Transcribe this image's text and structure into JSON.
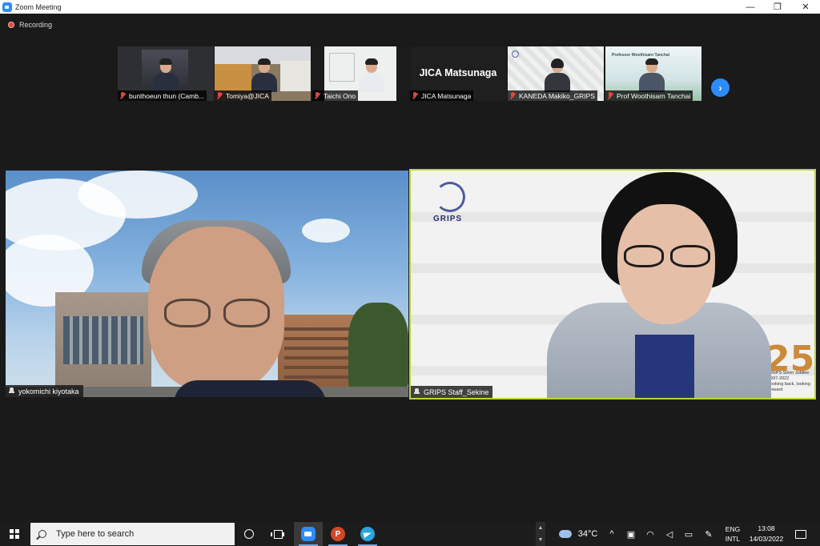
{
  "window": {
    "title": "Zoom Meeting",
    "controls": {
      "minimize": "—",
      "restore": "❐",
      "close": "✕"
    }
  },
  "meeting": {
    "recording_label": "Recording",
    "thumbnails": [
      {
        "name": "bunthoeun thun (Camb..."
      },
      {
        "name": "Tomiya@JICA"
      },
      {
        "name": "Taichi Ono"
      },
      {
        "name": "JICA Matsunaga",
        "display_text": "JICA Matsunaga"
      },
      {
        "name": "KANEDA Makiko_GRIPS"
      },
      {
        "name": "Prof Woothisarn Tanchai",
        "caption": "Professor Woothisarn Tanchai"
      }
    ],
    "next_button": "›",
    "videos": [
      {
        "name": "yokomichi kiyotaka"
      },
      {
        "name": "GRIPS Staff_Sekine",
        "logo_text": "GRIPS",
        "jubilee_number": "25",
        "jubilee_caption": [
          "GRIPS Silver Jubilee",
          "1997-2022",
          "Looking back, looking forward"
        ]
      }
    ],
    "colors": {
      "accent": "#2d8cff",
      "active_speaker_border": "#b8d53a",
      "muted_mic": "#e0483e"
    }
  },
  "taskbar": {
    "search_placeholder": "Type here to search",
    "ppt_letter": "P",
    "weather": {
      "temperature": "34°C"
    },
    "tray": {
      "chevron": "^",
      "lang_line1": "ENG",
      "lang_line2": "INTL"
    },
    "clock": {
      "time": "13:08",
      "date": "14/03/2022"
    },
    "scroll": {
      "up": "▲",
      "down": "▼"
    }
  }
}
